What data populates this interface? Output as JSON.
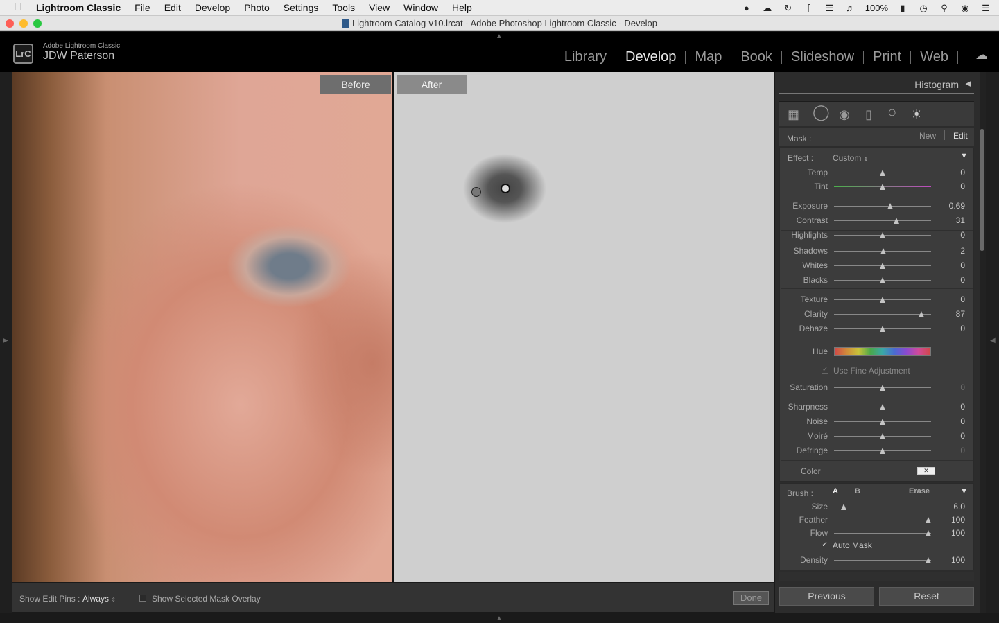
{
  "menubar": {
    "apple": "",
    "app_name": "Lightroom Classic",
    "items": [
      "File",
      "Edit",
      "Develop",
      "Photo",
      "Settings",
      "Tools",
      "View",
      "Window",
      "Help"
    ],
    "battery": "100%"
  },
  "window": {
    "title": "Lightroom Catalog-v10.lrcat - Adobe Photoshop Lightroom Classic - Develop"
  },
  "header": {
    "logo": "LrC",
    "product": "Adobe Lightroom Classic",
    "user": "JDW Paterson",
    "modules": [
      "Library",
      "Develop",
      "Map",
      "Book",
      "Slideshow",
      "Print",
      "Web"
    ],
    "active_module": "Develop"
  },
  "view": {
    "before_label": "Before",
    "after_label": "After"
  },
  "toolbar": {
    "show_edit_pins_label": "Show Edit Pins :",
    "show_edit_pins_value": "Always",
    "overlay_label": "Show Selected Mask Overlay",
    "overlay_checked": false,
    "done_label": "Done"
  },
  "panel": {
    "histogram_title": "Histogram",
    "mask_label": "Mask :",
    "mask_new": "New",
    "mask_edit": "Edit",
    "effect_label": "Effect :",
    "effect_value": "Custom",
    "sliders": [
      {
        "name": "temp",
        "label": "Temp",
        "value": "0",
        "pos": 0.5
      },
      {
        "name": "tint",
        "label": "Tint",
        "value": "0",
        "pos": 0.5
      },
      {
        "name": "exposure",
        "label": "Exposure",
        "value": "0.69",
        "pos": 0.58
      },
      {
        "name": "contrast",
        "label": "Contrast",
        "value": "31",
        "pos": 0.64
      },
      {
        "name": "highlights",
        "label": "Highlights",
        "value": "0",
        "pos": 0.5
      },
      {
        "name": "shadows",
        "label": "Shadows",
        "value": "2",
        "pos": 0.51
      },
      {
        "name": "whites",
        "label": "Whites",
        "value": "0",
        "pos": 0.5
      },
      {
        "name": "blacks",
        "label": "Blacks",
        "value": "0",
        "pos": 0.5
      },
      {
        "name": "texture",
        "label": "Texture",
        "value": "0",
        "pos": 0.5
      },
      {
        "name": "clarity",
        "label": "Clarity",
        "value": "87",
        "pos": 0.9
      },
      {
        "name": "dehaze",
        "label": "Dehaze",
        "value": "0",
        "pos": 0.5
      }
    ],
    "hue_label": "Hue",
    "fine_adjust_label": "Use Fine Adjustment",
    "saturation": {
      "label": "Saturation",
      "value": "0",
      "pos": 0.5
    },
    "detail_sliders": [
      {
        "name": "sharpness",
        "label": "Sharpness",
        "value": "0",
        "pos": 0.5
      },
      {
        "name": "noise",
        "label": "Noise",
        "value": "0",
        "pos": 0.5
      },
      {
        "name": "moire",
        "label": "Moiré",
        "value": "0",
        "pos": 0.5
      },
      {
        "name": "defringe",
        "label": "Defringe",
        "value": "0",
        "pos": 0.5
      }
    ],
    "color_label": "Color",
    "brush_label": "Brush :",
    "brush_a": "A",
    "brush_b": "B",
    "brush_erase": "Erase",
    "brush_sliders": [
      {
        "name": "size",
        "label": "Size",
        "value": "6.0",
        "pos": 0.1
      },
      {
        "name": "feather",
        "label": "Feather",
        "value": "100",
        "pos": 0.97
      },
      {
        "name": "flow",
        "label": "Flow",
        "value": "100",
        "pos": 0.97
      }
    ],
    "auto_mask_label": "Auto Mask",
    "auto_mask_checked": true,
    "density": {
      "label": "Density",
      "value": "100",
      "pos": 0.97
    },
    "previous_label": "Previous",
    "reset_label": "Reset"
  }
}
